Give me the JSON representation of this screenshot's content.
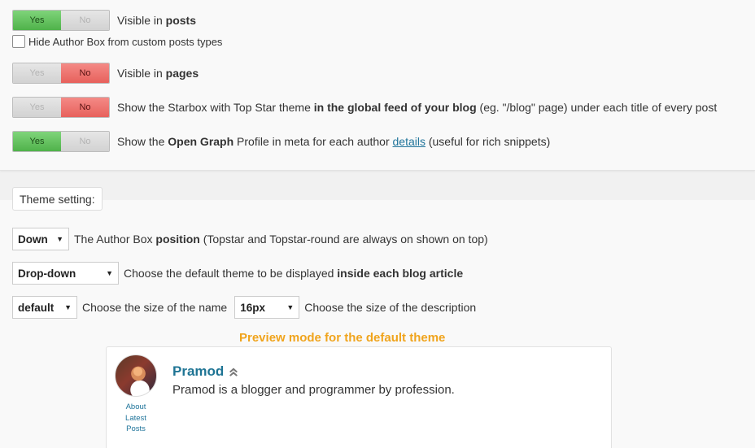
{
  "visibility": {
    "posts": {
      "yes": "Yes",
      "no": "No",
      "state": "yes",
      "label_pre": "Visible in ",
      "label_bold": "posts"
    },
    "hide_custom": {
      "label": "Hide Author Box from custom posts types"
    },
    "pages": {
      "yes": "Yes",
      "no": "No",
      "state": "no",
      "label_pre": "Visible in ",
      "label_bold": "pages"
    },
    "global_feed": {
      "yes": "Yes",
      "no": "No",
      "state": "no",
      "label_pre": "Show the Starbox with Top Star theme ",
      "label_bold": "in the global feed of your blog",
      "label_post": " (eg. \"/blog\" page) under each title of every post"
    },
    "open_graph": {
      "yes": "Yes",
      "no": "No",
      "state": "yes",
      "label_pre": "Show the ",
      "label_bold": "Open Graph",
      "label_mid": " Profile in meta for each author ",
      "link": "details",
      "label_post": " (useful for rich snippets)"
    }
  },
  "theme": {
    "button": "Theme setting:",
    "position": {
      "value": "Down",
      "label_pre": "The Author Box ",
      "label_bold": "position",
      "label_post": " (Topstar and Topstar-round are always on shown on top)"
    },
    "default_theme": {
      "value": "Drop-down",
      "label_pre": "Choose the default theme to be displayed ",
      "label_bold": "inside each blog article"
    },
    "name_size": {
      "value": "default",
      "label": "Choose the size of the name"
    },
    "desc_size": {
      "value": "16px",
      "label": "Choose the size of the description"
    }
  },
  "preview": {
    "title": "Preview mode for the default theme",
    "author": "Pramod",
    "description": "Pramod is a blogger and programmer by profession.",
    "links": [
      "About",
      "Latest",
      "Posts"
    ]
  },
  "colors": {
    "yes_on": "#5cbf57",
    "no_on": "#ee726d",
    "accent": "#f0a41d",
    "link": "#21759b"
  },
  "icons": [
    "chevron-up-icon",
    "dropdown-arrow-icon",
    "avatar"
  ]
}
